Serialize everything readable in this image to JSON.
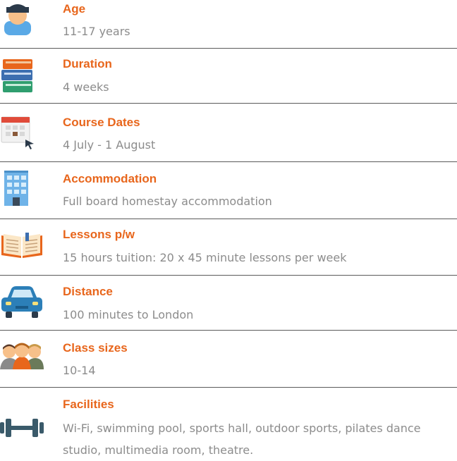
{
  "items": [
    {
      "title": "Age",
      "value": "11-17  years",
      "icon": "student-icon"
    },
    {
      "title": "Duration",
      "value": "4 weeks",
      "icon": "books-icon"
    },
    {
      "title": "Course Dates",
      "value": "4 July - 1 August",
      "icon": "calendar-icon"
    },
    {
      "title": "Accommodation",
      "value": "Full board homestay accommodation",
      "icon": "building-icon"
    },
    {
      "title": "Lessons p/w",
      "value": "15 hours tuition: 20 x 45 minute lessons per week",
      "icon": "open-book-icon"
    },
    {
      "title": "Distance",
      "value": "100 minutes to London",
      "icon": "car-icon"
    },
    {
      "title": "Class sizes",
      "value": "10-14",
      "icon": "people-icon"
    },
    {
      "title": "Facilities",
      "value": "Wi-Fi, swimming pool, sports hall, outdoor sports, pilates dance studio,  multimedia room, theatre.",
      "icon": "dumbbell-icon"
    }
  ],
  "colors": {
    "title": "#e8661c",
    "value": "#8c8c8c",
    "divider": "#5a5a5a"
  }
}
